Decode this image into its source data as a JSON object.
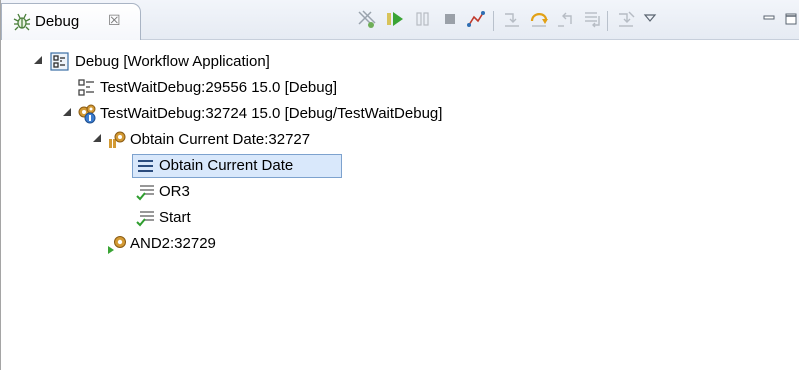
{
  "view": {
    "tab_label": "Debug",
    "tab_close_glyph": "☒",
    "tab_icon": "bug-icon"
  },
  "toolbar": {
    "buttons": [
      {
        "name": "remove-all-terminated-icon"
      },
      {
        "name": "resume-icon"
      },
      {
        "name": "suspend-icon"
      },
      {
        "name": "terminate-icon"
      },
      {
        "name": "disconnect-icon"
      },
      {
        "name": "step-into-icon"
      },
      {
        "name": "step-over-icon"
      },
      {
        "name": "step-return-icon"
      },
      {
        "name": "drop-to-frame-icon"
      },
      {
        "name": "use-step-filters-icon"
      },
      {
        "name": "view-menu-icon"
      },
      {
        "name": "minimize-icon"
      },
      {
        "name": "maximize-icon"
      }
    ],
    "colors": {
      "resume": "#3aa435",
      "terminate": "#8c8c8c",
      "disconnect": "#c0392b"
    }
  },
  "tree": {
    "items": [
      {
        "label": "Debug [Workflow Application]",
        "icon": "launch-config-icon",
        "expanded": true
      },
      {
        "label": "TestWaitDebug:29556 15.0 [Debug]",
        "icon": "terminated-process-icon"
      },
      {
        "label": "TestWaitDebug:32724 15.0 [Debug/TestWaitDebug]",
        "icon": "workflow-process-icon",
        "expanded": true
      },
      {
        "label": "Obtain Current Date:32727",
        "icon": "workflow-thread-icon",
        "expanded": true
      },
      {
        "label": "Obtain Current Date",
        "icon": "stack-frame-icon",
        "selected": true
      },
      {
        "label": "OR3",
        "icon": "completed-frame-icon"
      },
      {
        "label": "Start",
        "icon": "completed-frame-icon"
      },
      {
        "label": "AND2:32729",
        "icon": "running-thread-icon"
      }
    ],
    "selection_color": "#d9e8fb"
  }
}
